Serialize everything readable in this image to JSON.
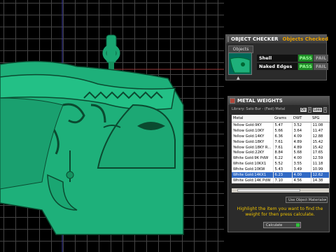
{
  "object_checker": {
    "title": "OBJECT CHECKER",
    "subtitle": "Objects Checked",
    "tab_objects": "Objects",
    "checks": [
      {
        "label": "Shell",
        "pass": "PASS",
        "fail": "FAIL"
      },
      {
        "label": "Naked Edges",
        "pass": "PASS",
        "fail": "FAIL"
      }
    ]
  },
  "metal_weights": {
    "title": "METAL WEIGHTS",
    "library": "Library: Sato Bur - (Fast) Metal",
    "oz_label": "Oz",
    "oz_btn": "i",
    "loss_label": "Loss",
    "loss_btn": "i",
    "columns": [
      "Metal",
      "Grams",
      "DWT",
      "SPG"
    ],
    "rows": [
      [
        "Yellow Gold:9KY",
        "5.47",
        "3.52",
        "11.08"
      ],
      [
        "Yellow Gold:10KY",
        "5.66",
        "3.64",
        "11.47"
      ],
      [
        "Yellow Gold:14KY",
        "6.36",
        "4.09",
        "12.88"
      ],
      [
        "Yellow Gold:18KY",
        "7.61",
        "4.89",
        "15.42"
      ],
      [
        "Yellow Gold:18KY R...",
        "7.61",
        "4.89",
        "15.42"
      ],
      [
        "Yellow Gold:22KY",
        "8.84",
        "5.68",
        "17.65"
      ],
      [
        "White Gold:9K PdW",
        "6.22",
        "4.00",
        "12.59"
      ],
      [
        "White Gold:10KX1",
        "5.52",
        "3.55",
        "11.18"
      ],
      [
        "White Gold:10KW",
        "5.43",
        "3.49",
        "10.99"
      ],
      [
        "White Gold:14KX1",
        "6.23",
        "4.00",
        "12.62"
      ],
      [
        "White Gold:14K PdW",
        "7.10",
        "4.56",
        "14.38"
      ]
    ],
    "selected_row": 9,
    "use_object_materials": "Use Object Materials",
    "hint": "Highlight the item you want to find the weight for then press calculate.",
    "calculate": "Calculate"
  }
}
